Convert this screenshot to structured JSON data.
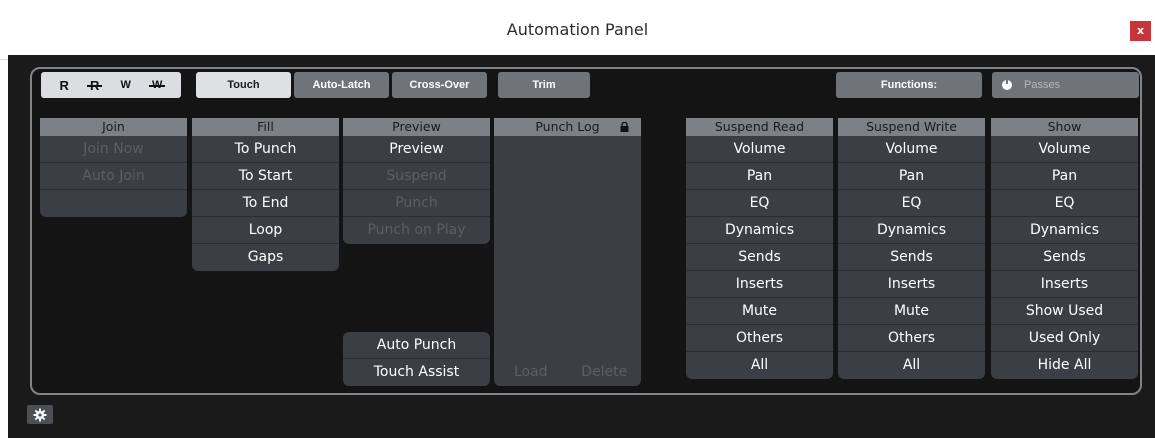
{
  "window": {
    "title": "Automation Panel",
    "close_label": "x"
  },
  "toolbar": {
    "modes": [
      "R",
      "R",
      "W",
      "W"
    ],
    "touch": "Touch",
    "auto_latch": "Auto-Latch",
    "cross_over": "Cross-Over",
    "trim": "Trim",
    "functions": "Functions:",
    "passes": "Passes"
  },
  "join": {
    "header": "Join",
    "items": [
      "Join Now",
      "Auto Join",
      ""
    ]
  },
  "fill": {
    "header": "Fill",
    "items": [
      "To Punch",
      "To Start",
      "To End",
      "Loop",
      "Gaps"
    ]
  },
  "preview": {
    "header": "Preview",
    "items": [
      "Preview",
      "Suspend",
      "Punch",
      "Punch on Play"
    ],
    "bottom_items": [
      "Auto Punch",
      "Touch Assist"
    ]
  },
  "punch_log": {
    "header": "Punch Log",
    "load": "Load",
    "delete": "Delete"
  },
  "suspend_read": {
    "header": "Suspend Read",
    "items": [
      "Volume",
      "Pan",
      "EQ",
      "Dynamics",
      "Sends",
      "Inserts",
      "Mute",
      "Others",
      "All"
    ]
  },
  "suspend_write": {
    "header": "Suspend Write",
    "items": [
      "Volume",
      "Pan",
      "EQ",
      "Dynamics",
      "Sends",
      "Inserts",
      "Mute",
      "Others",
      "All"
    ]
  },
  "show": {
    "header": "Show",
    "items": [
      "Volume",
      "Pan",
      "EQ",
      "Dynamics",
      "Sends",
      "Inserts",
      "Show Used",
      "Used Only",
      "Hide All"
    ]
  },
  "colors": {
    "close": "#c7343a",
    "header": "#7d8186",
    "cell": "#3b3e42",
    "disabled_text": "#5b5f63",
    "active": "#dfe0e2"
  }
}
